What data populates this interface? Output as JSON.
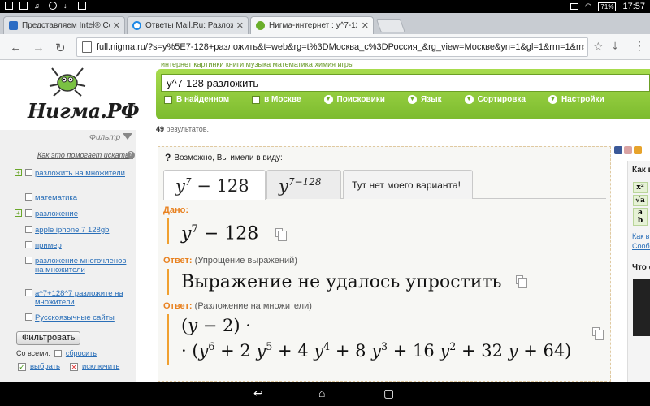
{
  "status": {
    "time": "17:57",
    "battery": "71%"
  },
  "tabs": [
    {
      "label": "Представляем Intel® Com",
      "color": "#2b6cc4"
    },
    {
      "label": "Ответы Mail.Ru: Разложит",
      "color": "#1e88e5"
    },
    {
      "label": "Нигма-интернет : y^7-128 р",
      "color": "#6aae2a"
    }
  ],
  "omnibox": {
    "url": "full.nigma.ru/?s=y%5E7-128+разложить&t=web&rg=t%3DМосква_с%3DРоссия_&rg_view=Москве&yn=1&gl=1&rm=1&ms=1&yh=1&a"
  },
  "logo": {
    "text": "Нигма.РФ"
  },
  "search": {
    "query": "y^7-128 разложить",
    "topnav": "интернет   картинки   книги   музыка   математика   химия игры",
    "options": {
      "in_found": "В найденном",
      "in_moscow": "в Москве",
      "engines": "Поисковики",
      "language": "Язык",
      "sorting": "Сортировка",
      "settings": "Настройки"
    }
  },
  "results": {
    "count": "49",
    "label": "результатов."
  },
  "sidebar": {
    "filter_title": "Фильтр",
    "help": "Как это помогает искать?",
    "items": [
      {
        "label": "разложить на множители"
      },
      {
        "label": "математика"
      },
      {
        "label": "разложение"
      },
      {
        "label": "apple iphone 7 128gb"
      },
      {
        "label": "пример"
      },
      {
        "label": "разложение многочленов на множители"
      },
      {
        "label": "a^7+128^7 разложите на множители"
      },
      {
        "label": "Русскоязычные сайты"
      }
    ],
    "filter_button": "Фильтровать",
    "with_all": "Со всеми:",
    "reset": "сбросить",
    "select": "выбрать",
    "exclude": "исключить"
  },
  "card": {
    "question": "Возможно, Вы имели в виду:",
    "tab_plain": "Тут нет моего варианта!",
    "given_label": "Дано:",
    "answer_label": "Ответ:",
    "answer1_note": "(Упрощение выражений)",
    "answer1_text": "Выражение не удалось упростить",
    "answer2_note": "(Разложение на множители)"
  },
  "rightbox": {
    "title": "Как в",
    "link1": "Как в",
    "link2": "Сообщ",
    "title2": "Что с"
  }
}
